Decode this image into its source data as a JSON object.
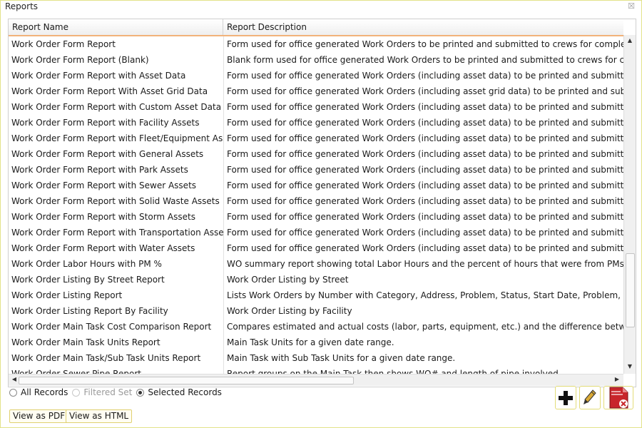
{
  "window": {
    "title": "Reports",
    "close_glyph": "☒"
  },
  "grid": {
    "columns": [
      "Report Name",
      "Report Description"
    ],
    "rows": [
      [
        "Work Order Form Report",
        "Form used for office generated Work Orders to be printed and submitted to crews for completion."
      ],
      [
        "Work Order Form Report (Blank)",
        "Blank form used for office generated Work Orders to be printed and submitted to crews for completion"
      ],
      [
        "Work Order Form Report with Asset Data",
        "Form used for office generated Work Orders (including asset data) to be printed and submitted to crew"
      ],
      [
        "Work Order Form Report With Asset Grid Data",
        "Form used for office generated Work Orders (including asset grid data) to be printed and submitted to"
      ],
      [
        "Work Order Form Report with Custom Asset Data",
        "Form used for office generated Work Orders (including asset data) to be printed and submitted to crew"
      ],
      [
        "Work Order Form Report with Facility Assets",
        "Form used for office generated Work Orders (including asset data) to be printed and submitted to crew"
      ],
      [
        "Work Order Form Report with Fleet/Equipment Assets",
        "Form used for office generated Work Orders (including asset data) to be printed and submitted to crew"
      ],
      [
        "Work Order Form Report with General Assets",
        "Form used for office generated Work Orders (including asset data) to be printed and submitted to crew"
      ],
      [
        "Work Order Form Report with Park Assets",
        "Form used for office generated Work Orders (including asset data) to be printed and submitted to crew"
      ],
      [
        "Work Order Form Report with Sewer Assets",
        "Form used for office generated Work Orders (including asset data) to be printed and submitted to crew"
      ],
      [
        "Work Order Form Report with Solid Waste Assets",
        "Form used for office generated Work Orders (including asset data) to be printed and submitted to crew"
      ],
      [
        "Work Order Form Report with Storm Assets",
        "Form used for office generated Work Orders (including asset data) to be printed and submitted to crew"
      ],
      [
        "Work Order Form Report with Transportation Assets",
        "Form used for office generated Work Orders (including asset data) to be printed and submitted to crew"
      ],
      [
        "Work Order Form Report with Water Assets",
        "Form used for office generated Work Orders (including asset data) to be printed and submitted to crew"
      ],
      [
        "Work Order Labor Hours with PM %",
        "WO summary report showing total Labor Hours and the percent of hours that were from PMs."
      ],
      [
        "Work Order Listing By Street Report",
        "Work Order Listing by Street"
      ],
      [
        "Work Order Listing Report",
        "Lists Work Orders by Number with Category, Address, Problem, Status, Start Date, Problem, and Action"
      ],
      [
        "Work Order Listing Report By Facility",
        "Work Order Listing by Facility"
      ],
      [
        "Work Order Main Task Cost Comparison Report",
        "Compares estimated and actual costs (labor, parts, equipment, etc.) and the difference between them"
      ],
      [
        "Work Order Main Task Units Report",
        "Main Task Units for a given date range."
      ],
      [
        "Work Order Main Task/Sub Task Units Report",
        "Main Task with Sub Task Units for a given date range."
      ],
      [
        "Work Order Sewer Pipe Report",
        "Report groups on the Main Task then shows WO# and length of pipe involved."
      ]
    ]
  },
  "scroll": {
    "up": "▲",
    "down": "▼",
    "left": "◀",
    "right": "▶"
  },
  "record_options": [
    {
      "label": "All Records",
      "state": "unchecked"
    },
    {
      "label": "Filtered Set",
      "state": "disabled"
    },
    {
      "label": "Selected Records",
      "state": "checked"
    }
  ],
  "buttons": {
    "pdf": "View as PDF",
    "html": "View as HTML"
  },
  "toolbar_icons": [
    "add-icon",
    "edit-pencil-icon",
    "delete-pdf-icon"
  ],
  "colors": {
    "header_underline": "#f2b27a",
    "button_border": "#e0d070",
    "delete_red": "#c8262b"
  }
}
